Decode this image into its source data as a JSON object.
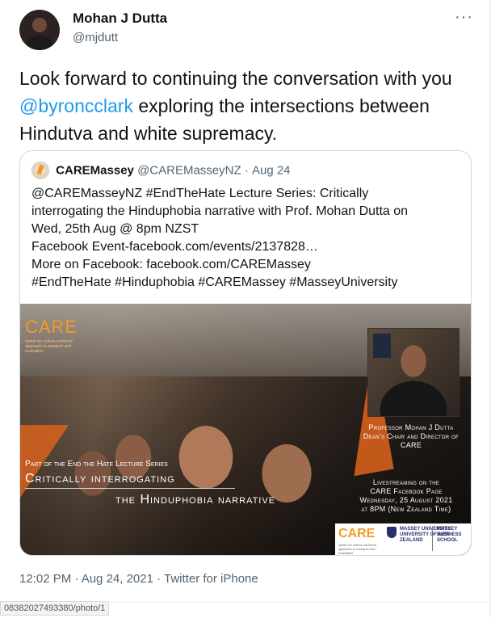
{
  "author": {
    "name": "Mohan J Dutta",
    "handle": "@mjdutt"
  },
  "more_glyph": "···",
  "tweet": {
    "text_before": "Look forward to continuing the conversation with you ",
    "mention": "@byroncclark",
    "text_after": " exploring the intersections between Hindutva and white supremacy."
  },
  "quote": {
    "name": "CAREMassey",
    "handle": "@CAREMasseyNZ",
    "dot": "·",
    "date": "Aug 24",
    "lines": [
      "@CAREMasseyNZ #EndTheHate Lecture Series: Critically",
      "interrogating the Hinduphobia narrative with Prof. Mohan Dutta on",
      "Wed, 25th Aug @ 8pm NZST",
      "Facebook Event-facebook.com/events/2137828…",
      "More on Facebook: facebook.com/CAREMassey",
      "#EndTheHate #Hinduphobia #CAREMassey #MasseyUniversity"
    ],
    "media": {
      "care_logo": "CARE",
      "care_sub": "center for culture-centered approach to research and evaluation",
      "prof_line1": "Professor Mohan J Dutta",
      "prof_line2": "Dean's Chair and Director of",
      "prof_line3": "CARE",
      "series_label": "Part of the End the Hate Lecture Series",
      "title_line1": "Critically interrogating",
      "title_line2": "the Hinduphobia narrative",
      "live_line1": "Livestreaming on the",
      "live_line2": "CARE Facebook Page",
      "live_line3": "Wednesday, 25 August 2021",
      "live_line4": "at 8PM (New Zealand Time)",
      "logo_care": "CARE",
      "logo_care_sub": "center for culture-centered approach to research and evaluation",
      "logo_massey": "MASSEY UNIVERSITY",
      "logo_massey_sub": "UNIVERSITY OF NEW ZEALAND",
      "logo_school": "MASSEY BUSINESS SCHOOL"
    }
  },
  "meta": "12:02 PM · Aug 24, 2021 · Twitter for iPhone",
  "status_url": "08382027493380/photo/1",
  "colors": {
    "link": "#1d9bf0",
    "muted": "#536471",
    "care_orange": "#f39a2b"
  }
}
